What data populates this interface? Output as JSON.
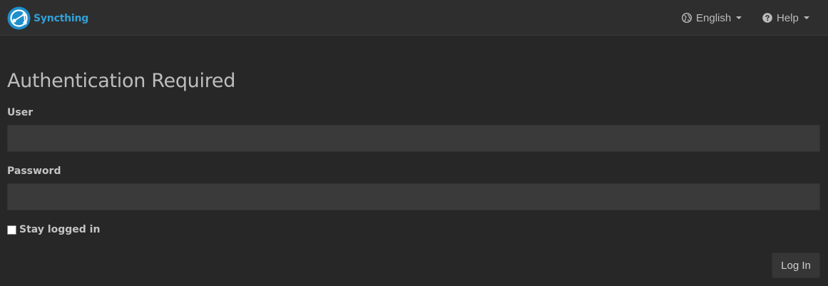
{
  "navbar": {
    "brand_name": "Syncthing",
    "brand_icon": "syncthing-logo-icon",
    "brand_color": "#31a1d8",
    "language_menu": {
      "label": "English",
      "icon": "globe-icon"
    },
    "help_menu": {
      "label": "Help",
      "icon": "question-circle-icon"
    }
  },
  "main": {
    "title": "Authentication Required",
    "user_label": "User",
    "user_value": "",
    "password_label": "Password",
    "password_value": "",
    "remember_label": "Stay logged in",
    "remember_checked": false,
    "login_button_label": "Log In"
  },
  "colors": {
    "background": "#272727",
    "navbar": "#2e2e2e",
    "input": "#3a3a3a",
    "accent": "#31a1d8"
  }
}
